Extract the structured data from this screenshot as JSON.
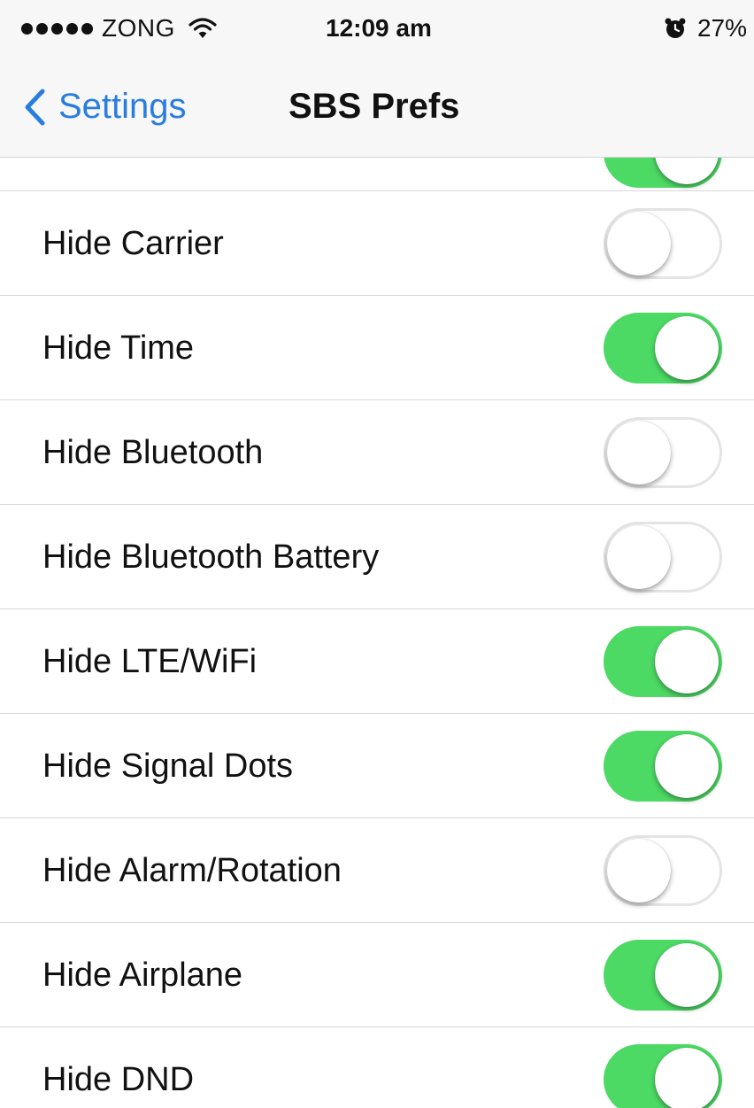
{
  "status_bar": {
    "carrier": "ZONG",
    "time": "12:09 am",
    "battery": "27%",
    "signal_icon": "signal-dots-icon",
    "wifi_icon": "wifi-icon",
    "alarm_icon": "alarm-clock-icon"
  },
  "nav": {
    "back_label": "Settings",
    "back_icon": "chevron-left-icon",
    "title": "SBS Prefs"
  },
  "colors": {
    "accent": "#2a7de0",
    "toggle_on": "#4cd964",
    "separator": "#d8d8dc"
  },
  "partial_row": {
    "on": true
  },
  "rows": [
    {
      "label": "Hide Carrier",
      "on": false
    },
    {
      "label": "Hide Time",
      "on": true
    },
    {
      "label": "Hide Bluetooth",
      "on": false
    },
    {
      "label": "Hide Bluetooth Battery",
      "on": false
    },
    {
      "label": "Hide LTE/WiFi",
      "on": true
    },
    {
      "label": "Hide Signal Dots",
      "on": true
    },
    {
      "label": "Hide Alarm/Rotation",
      "on": false
    },
    {
      "label": "Hide Airplane",
      "on": true
    },
    {
      "label": "Hide DND",
      "on": true
    }
  ]
}
